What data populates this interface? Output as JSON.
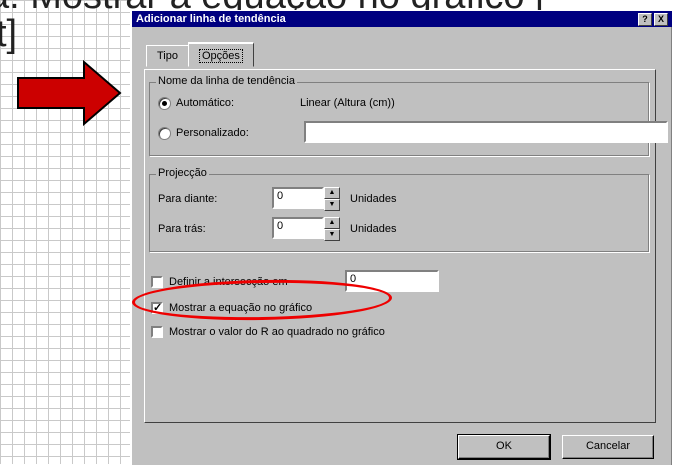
{
  "slide": {
    "title_line1": "a. Mostrar a equação no gráfico [",
    "title_line2": "t]"
  },
  "dialog": {
    "title": "Adicionar linha de tendência",
    "help_btn": "?",
    "close_btn": "X",
    "tabs": [
      {
        "label": "Tipo",
        "active": false
      },
      {
        "label": "Opções",
        "active": true
      }
    ],
    "trend_name": {
      "legend": "Nome da linha de tendência",
      "automatic_label": "Automático:",
      "automatic_value": "Linear (Altura (cm))",
      "custom_label": "Personalizado:",
      "custom_value": "",
      "selected": "automatic"
    },
    "projection": {
      "legend": "Projecção",
      "forward_label": "Para diante:",
      "forward_value": "0",
      "backward_label": "Para trás:",
      "backward_value": "0",
      "units": "Unidades"
    },
    "intercept": {
      "label": "Definir a intersecção em",
      "value": "0",
      "checked": false
    },
    "show_equation": {
      "label": "Mostrar a equação no gráfico",
      "checked": true
    },
    "show_r2": {
      "label": "Mostrar o valor do R ao quadrado no gráfico",
      "checked": false
    },
    "ok_label": "OK",
    "cancel_label": "Cancelar"
  },
  "colors": {
    "arrow": "#cc0000",
    "highlight": "#ee0000",
    "titlebar": "#000080",
    "face": "#c0c0c0"
  }
}
